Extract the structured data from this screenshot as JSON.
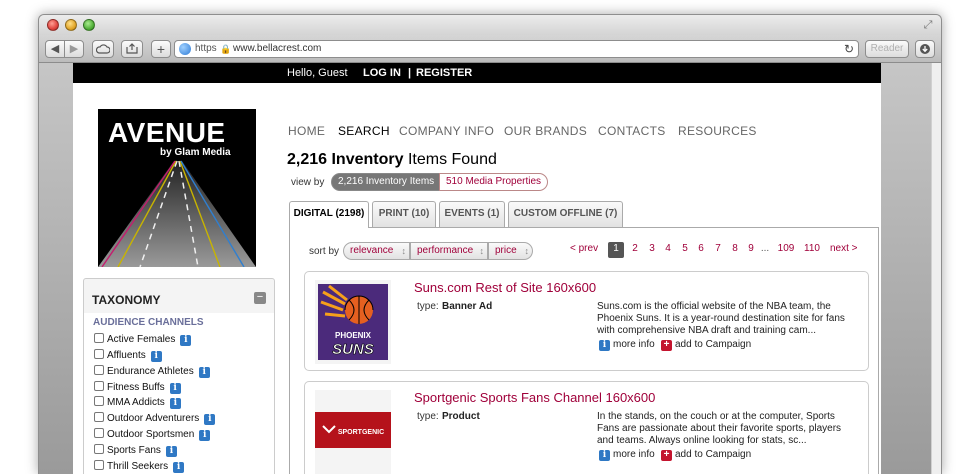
{
  "browser": {
    "url_scheme": "https",
    "url": "www.bellacrest.com",
    "reader_label": "Reader",
    "newtab_label": "+",
    "back_label": "◀",
    "forward_label": "▶"
  },
  "topbar": {
    "greeting": "Hello, Guest",
    "login": "LOG IN",
    "separator": "|",
    "register": "REGISTER"
  },
  "logo": {
    "title": "AVENUE",
    "subtitle": "by Glam Media"
  },
  "nav": {
    "items": [
      "HOME",
      "SEARCH",
      "COMPANY INFO",
      "OUR BRANDS",
      "CONTACTS",
      "RESOURCES"
    ],
    "active": "SEARCH"
  },
  "results_header": {
    "count": "2,216 Inventory",
    "suffix": " Items Found",
    "view_by": "view by",
    "inventory_pill": "2,216 Inventory Items",
    "media_pill": "510 Media Properties"
  },
  "tabs": [
    "DIGITAL (2198)",
    "PRINT (10)",
    "EVENTS (1)",
    "CUSTOM OFFLINE (7)"
  ],
  "sort": {
    "label": "sort by",
    "options": [
      "relevance",
      "performance",
      "price"
    ]
  },
  "pagination": {
    "prev": "< prev",
    "pages": [
      "1",
      "2",
      "3",
      "4",
      "5",
      "6",
      "7",
      "8",
      "9"
    ],
    "ellipsis": "...",
    "last_pages": [
      "109",
      "110"
    ],
    "next": "next >",
    "current": "1"
  },
  "taxonomy": {
    "title": "TAXONOMY",
    "collapse": "−",
    "section": "AUDIENCE CHANNELS",
    "items": [
      "Active Females",
      "Affluents",
      "Endurance Athletes",
      "Fitness Buffs",
      "MMA Addicts",
      "Outdoor Adventurers",
      "Outdoor Sportsmen",
      "Sports Fans",
      "Thrill Seekers"
    ]
  },
  "listings": [
    {
      "title": "Suns.com Rest of Site 160x600",
      "type_label": "type:",
      "type": "Banner Ad",
      "description": "Suns.com is the official website of the NBA team, the Phoenix Suns. It is a year-round destination site for fans with comprehensive NBA draft and training cam...",
      "more_info": "more info",
      "add": "add to Campaign",
      "logo_text_top": "PHOENIX",
      "logo_text_bottom": "SUNS"
    },
    {
      "title": "Sportgenic Sports Fans Channel 160x600",
      "type_label": "type:",
      "type": "Product",
      "description": "In the stands, on the couch or at the computer, Sports Fans are passionate about their favorite sports, players and teams. Always online looking for stats, sc...",
      "more_info": "more info",
      "add": "add to Campaign",
      "logo_text": "SPORTGENIC"
    }
  ],
  "colors": {
    "accent": "#a0003a",
    "info_blue": "#2f78c4",
    "add_red": "#c4142e",
    "suns_purple": "#4b2a7b",
    "suns_orange": "#e56020",
    "sportgenic_red": "#b5121b"
  }
}
